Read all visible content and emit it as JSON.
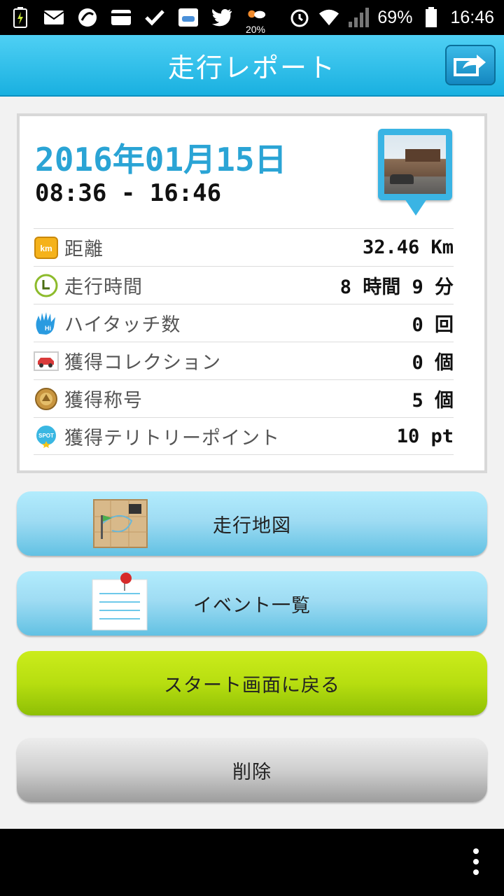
{
  "status_bar": {
    "battery_percent": "69%",
    "clock": "16:46",
    "weather_percent": "20%",
    "icons": [
      "battery-charging-icon",
      "mail-icon",
      "sync-icon",
      "pass-icon",
      "check-icon",
      "app-icon",
      "twitter-icon",
      "weather-icon",
      "alarm-icon",
      "wifi-icon",
      "signal-icon",
      "battery-icon"
    ]
  },
  "header": {
    "title": "走行レポート",
    "share_icon": "share-icon"
  },
  "report": {
    "date": "2016年01月15日",
    "time_range": "08:36 - 16:46",
    "stats": [
      {
        "icon": "km-icon",
        "label": "距離",
        "value": "32.46 Km"
      },
      {
        "icon": "clock-icon",
        "label": "走行時間",
        "value": "8 時間 9 分"
      },
      {
        "icon": "high-touch-icon",
        "label": "ハイタッチ数",
        "value": "0 回"
      },
      {
        "icon": "car-collection-icon",
        "label": "獲得コレクション",
        "value": "0 個"
      },
      {
        "icon": "title-medal-icon",
        "label": "獲得称号",
        "value": "5 個"
      },
      {
        "icon": "spot-icon",
        "label": "獲得テリトリーポイント",
        "value": "10 pt"
      }
    ]
  },
  "buttons": {
    "map": "走行地図",
    "events": "イベント一覧",
    "back_to_start": "スタート画面に戻る",
    "delete": "削除"
  },
  "colors": {
    "header": "#19b0e0",
    "date_text": "#2aa4d5",
    "button_blue": "#9fdcf3",
    "button_green": "#b7de10",
    "button_gray": "#cfcfcf"
  }
}
